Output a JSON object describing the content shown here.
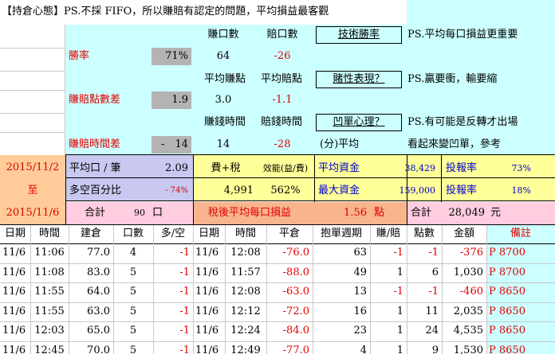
{
  "title": "【持倉心態】PS.不採 FIFO，所以賺賠有認定的問題，平均損益最客觀",
  "summary": {
    "hdr_win_count": "賺口數",
    "hdr_loss_count": "賠口數",
    "tech_win_rate_btn": "技術勝率",
    "note1": "PS.平均每口損益更重要",
    "win_rate_label": "勝率",
    "win_rate_value": "71%",
    "win_count": "64",
    "loss_count": "-26",
    "hdr_avg_win_pts": "平均賺點",
    "hdr_avg_loss_pts": "平均賠點",
    "gambling_btn": "賭性表現？",
    "note2": "PS.贏要衝，輸要縮",
    "pt_diff_label": "賺賠點數差",
    "pt_diff_value": "1.9",
    "avg_win_pts": "3.0",
    "avg_loss_pts": "-1.1",
    "hdr_win_time": "賺錢時間",
    "hdr_loss_time": "賠錢時間",
    "trapped_btn": "凹單心理？",
    "note3": "PS.有可能是反轉才出場",
    "time_diff_label": "賺賠時間差",
    "time_diff_sign": "-",
    "time_diff_value": "14",
    "win_time": "14",
    "loss_time": "-28",
    "minutes_avg": "(分)平均",
    "note4": "看起來變凹單，參考",
    "date_from": "2015/11/2",
    "date_to_word": "至",
    "date_to": "2015/11/6",
    "avg_per_lot_label": "平均口 / 筆",
    "avg_per_lot_value": "2.09",
    "fee_tax_label": "費+稅",
    "efficiency_label": "效能(益/費)",
    "avg_capital_label": "平均資金",
    "avg_capital_value": "38,429",
    "roi_label1": "投報率",
    "roi_value1": "73%",
    "long_short_label": "多空百分比",
    "long_short_value": "- 74%",
    "fee_tax_value": "4,991",
    "efficiency_value": "562%",
    "max_capital_label": "最大資金",
    "max_capital_value": "159,000",
    "roi_label2": "投報率",
    "roi_value2": "18%",
    "total_label": "合計",
    "total_lots": "90",
    "total_lots_unit": "口",
    "after_tax_label": "稅後平均每口損益",
    "after_tax_value": "1.56",
    "after_tax_unit": "點",
    "grand_total_label": "合計",
    "grand_total_value": "28,049",
    "grand_total_unit": "元"
  },
  "table": {
    "headers": [
      "日期",
      "時間",
      "建倉",
      "口數",
      "多/空",
      "日期",
      "時間",
      "平倉",
      "抱單週期",
      "賺/賠",
      "點數",
      "金額",
      "備註"
    ],
    "rows": [
      [
        "11/6",
        "11:06",
        "77.0",
        "4",
        "-1",
        "11/6",
        "12:08",
        "-76.0",
        "63",
        "-1",
        "-1",
        "-376",
        "P 8700"
      ],
      [
        "11/6",
        "11:08",
        "83.0",
        "5",
        "-1",
        "11/6",
        "11:57",
        "-88.0",
        "49",
        "1",
        "6",
        "1,030",
        "P 8700"
      ],
      [
        "11/6",
        "11:55",
        "64.0",
        "5",
        "-1",
        "11/6",
        "12:08",
        "-63.0",
        "13",
        "-1",
        "-1",
        "-460",
        "P 8650"
      ],
      [
        "11/6",
        "11:55",
        "63.0",
        "5",
        "-1",
        "11/6",
        "12:12",
        "-72.0",
        "16",
        "1",
        "11",
        "2,035",
        "P 8650"
      ],
      [
        "11/6",
        "12:03",
        "65.0",
        "5",
        "-1",
        "11/6",
        "12:24",
        "-84.0",
        "23",
        "1",
        "24",
        "4,535",
        "P 8650"
      ],
      [
        "11/6",
        "12:45",
        "70.0",
        "5",
        "-1",
        "11/6",
        "12:49",
        "-77.0",
        "4",
        "1",
        "9",
        "1,530",
        "P 8650"
      ]
    ]
  },
  "colors": {
    "panel": "#ccffff",
    "gray_input": "#b3b3b3",
    "yellow": "#ffff99",
    "purple": "#c8c8f0",
    "salmon": "#f8b48c",
    "pink": "#ffcce0",
    "negative": "#e00000"
  }
}
